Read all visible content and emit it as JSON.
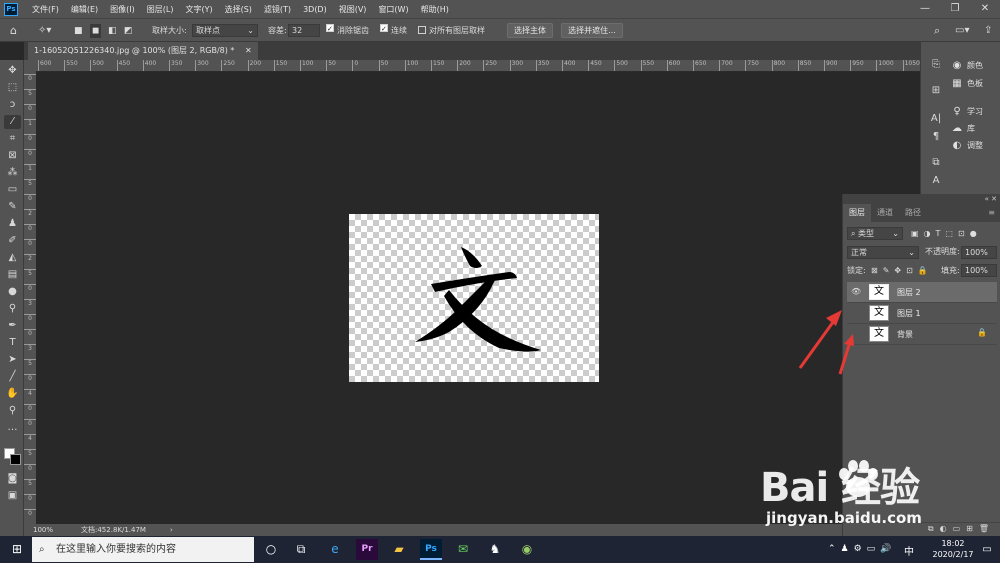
{
  "menubar": {
    "logo": "Ps",
    "items": [
      "文件(F)",
      "编辑(E)",
      "图像(I)",
      "图层(L)",
      "文字(Y)",
      "选择(S)",
      "滤镜(T)",
      "3D(D)",
      "视图(V)",
      "窗口(W)",
      "帮助(H)"
    ]
  },
  "options": {
    "sample_size_label": "取样大小:",
    "sample_size_value": "取样点",
    "tolerance_label": "容差:",
    "tolerance_value": "32",
    "antialias_label": "消除锯齿",
    "contiguous_label": "连续",
    "all_layers_label": "对所有图层取样",
    "select_subject": "选择主体",
    "select_mask": "选择并遮住..."
  },
  "document": {
    "tab_title": "1-16052Q51226340.jpg @ 100% (图层 2, RGB/8) *",
    "glyph": "文",
    "zoom": "100%",
    "doc_info": "文档:452.8K/1.47M"
  },
  "ruler": {
    "top": [
      "600",
      "550",
      "500",
      "450",
      "400",
      "350",
      "300",
      "250",
      "200",
      "150",
      "100",
      "50",
      "0",
      "50",
      "100",
      "150",
      "200",
      "250",
      "300",
      "350",
      "400",
      "450",
      "500",
      "550",
      "600",
      "650",
      "700",
      "750",
      "800",
      "850",
      "900",
      "950",
      "1000",
      "1050"
    ],
    "left": [
      "0",
      "5",
      "0",
      "1",
      "0",
      "0",
      "1",
      "5",
      "0",
      "2",
      "0",
      "0",
      "2",
      "5",
      "0",
      "3",
      "0",
      "0",
      "3",
      "5",
      "0",
      "4",
      "0",
      "0",
      "4",
      "5",
      "0",
      "5",
      "0",
      "0"
    ]
  },
  "dock": {
    "items": [
      {
        "icon": "🎨",
        "label": "颜色"
      },
      {
        "icon": "▦",
        "label": "色板"
      },
      {
        "icon": "💡",
        "label": "学习"
      },
      {
        "icon": "☁",
        "label": "库"
      },
      {
        "icon": "◐",
        "label": "调整"
      }
    ]
  },
  "layers": {
    "tabs": [
      "图层",
      "通道",
      "路径"
    ],
    "filter_label": "类型",
    "blend_mode": "正常",
    "opacity_label": "不透明度:",
    "opacity_value": "100%",
    "lock_label": "锁定:",
    "fill_label": "填充:",
    "fill_value": "100%",
    "items": [
      {
        "name": "图层 2",
        "thumb": "文",
        "visible": true,
        "selected": true,
        "locked": false
      },
      {
        "name": "图层 1",
        "thumb": "文",
        "visible": false,
        "selected": false,
        "locked": false
      },
      {
        "name": "背景",
        "thumb": "文",
        "visible": false,
        "selected": false,
        "locked": true
      }
    ]
  },
  "taskbar": {
    "search_placeholder": "在这里输入你要搜索的内容",
    "time": "18:02",
    "date": "2020/2/17",
    "ime": "中"
  },
  "watermark": {
    "logo": "Bai  经验",
    "url": "jingyan.baidu.com"
  },
  "colors": {
    "accent_arrow": "#e53935",
    "ps_blue": "#31a8ff"
  }
}
